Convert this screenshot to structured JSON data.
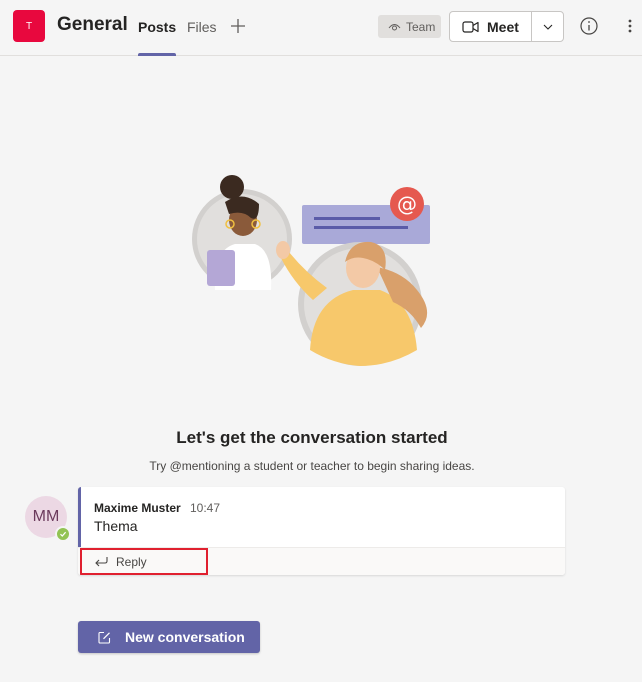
{
  "header": {
    "team_initial": "T",
    "channel_name": "General",
    "tabs": [
      {
        "label": "Posts",
        "active": true
      },
      {
        "label": "Files",
        "active": false
      }
    ],
    "team_badge": "Team",
    "meet_label": "Meet"
  },
  "empty_state": {
    "title": "Let's get the conversation started",
    "subtitle": "Try @mentioning a student or teacher to begin sharing ideas."
  },
  "message": {
    "avatar_initials": "MM",
    "author": "Maxime Muster",
    "time": "10:47",
    "body": "Thema",
    "reply_label": "Reply"
  },
  "compose": {
    "new_conversation_label": "New conversation"
  },
  "colors": {
    "accent": "#6264a7",
    "team_avatar": "#e8083e",
    "presence_available": "#92c353",
    "highlight": "#e0202f"
  }
}
